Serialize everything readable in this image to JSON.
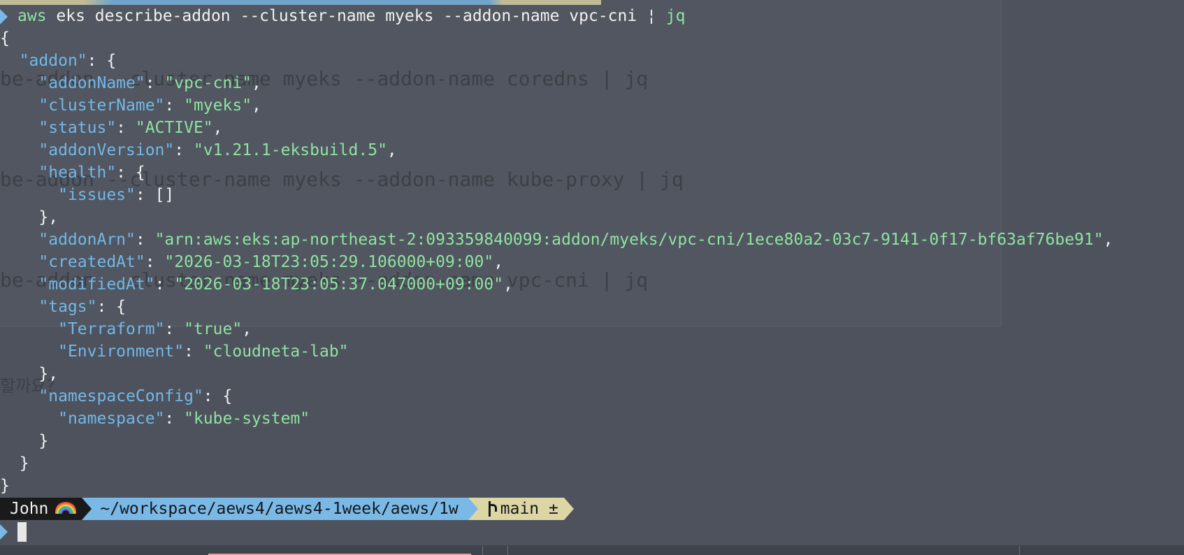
{
  "background_window": {
    "ghost_lines": [
      "be-addon --cluster-name myeks --addon-name coredns | jq",
      "be-addon --cluster-name myeks --addon-name kube-proxy | jq",
      "be-addon --cluster-name myeks --addon-name vpc-cni | jq"
    ],
    "ghost_korean": "할까요?"
  },
  "command": {
    "program": "aws",
    "args": " eks describe-addon --cluster-name myeks --addon-name vpc-cni ",
    "pipe": "¦",
    "filter": " jq"
  },
  "json_output": {
    "open_brace": "{",
    "addon_key": "\"addon\"",
    "fields": {
      "addonName": {
        "key": "\"addonName\"",
        "value": "\"vpc-cni\""
      },
      "clusterName": {
        "key": "\"clusterName\"",
        "value": "\"myeks\""
      },
      "status": {
        "key": "\"status\"",
        "value": "\"ACTIVE\""
      },
      "addonVersion": {
        "key": "\"addonVersion\"",
        "value": "\"v1.21.1-eksbuild.5\""
      },
      "health": {
        "key": "\"health\""
      },
      "issues": {
        "key": "\"issues\"",
        "value": "[]"
      },
      "addonArn": {
        "key": "\"addonArn\"",
        "value": "\"arn:aws:eks:ap-northeast-2:093359840099:addon/myeks/vpc-cni/1ece80a2-03c7-9141-0f17-bf63af76be91\""
      },
      "createdAt": {
        "key": "\"createdAt\"",
        "value": "\"2026-03-18T23:05:29.106000+09:00\""
      },
      "modifiedAt": {
        "key": "\"modifiedAt\"",
        "value": "\"2026-03-18T23:05:37.047000+09:00\""
      },
      "tags": {
        "key": "\"tags\""
      },
      "terraform": {
        "key": "\"Terraform\"",
        "value": "\"true\""
      },
      "environment": {
        "key": "\"Environment\"",
        "value": "\"cloudneta-lab\""
      },
      "namespaceConfig": {
        "key": "\"namespaceConfig\""
      },
      "namespace": {
        "key": "\"namespace\"",
        "value": "\"kube-system\""
      }
    }
  },
  "prompt": {
    "user": "John",
    "path": "~/workspace/aews4/aews4-1week/aews/1w",
    "branch": "main ±"
  },
  "colors": {
    "background": "#4e525d",
    "json_key": "#72b8e8",
    "json_string": "#8fe3a1",
    "path_segment": "#7ab8e6",
    "git_segment": "#dcd6a5"
  }
}
